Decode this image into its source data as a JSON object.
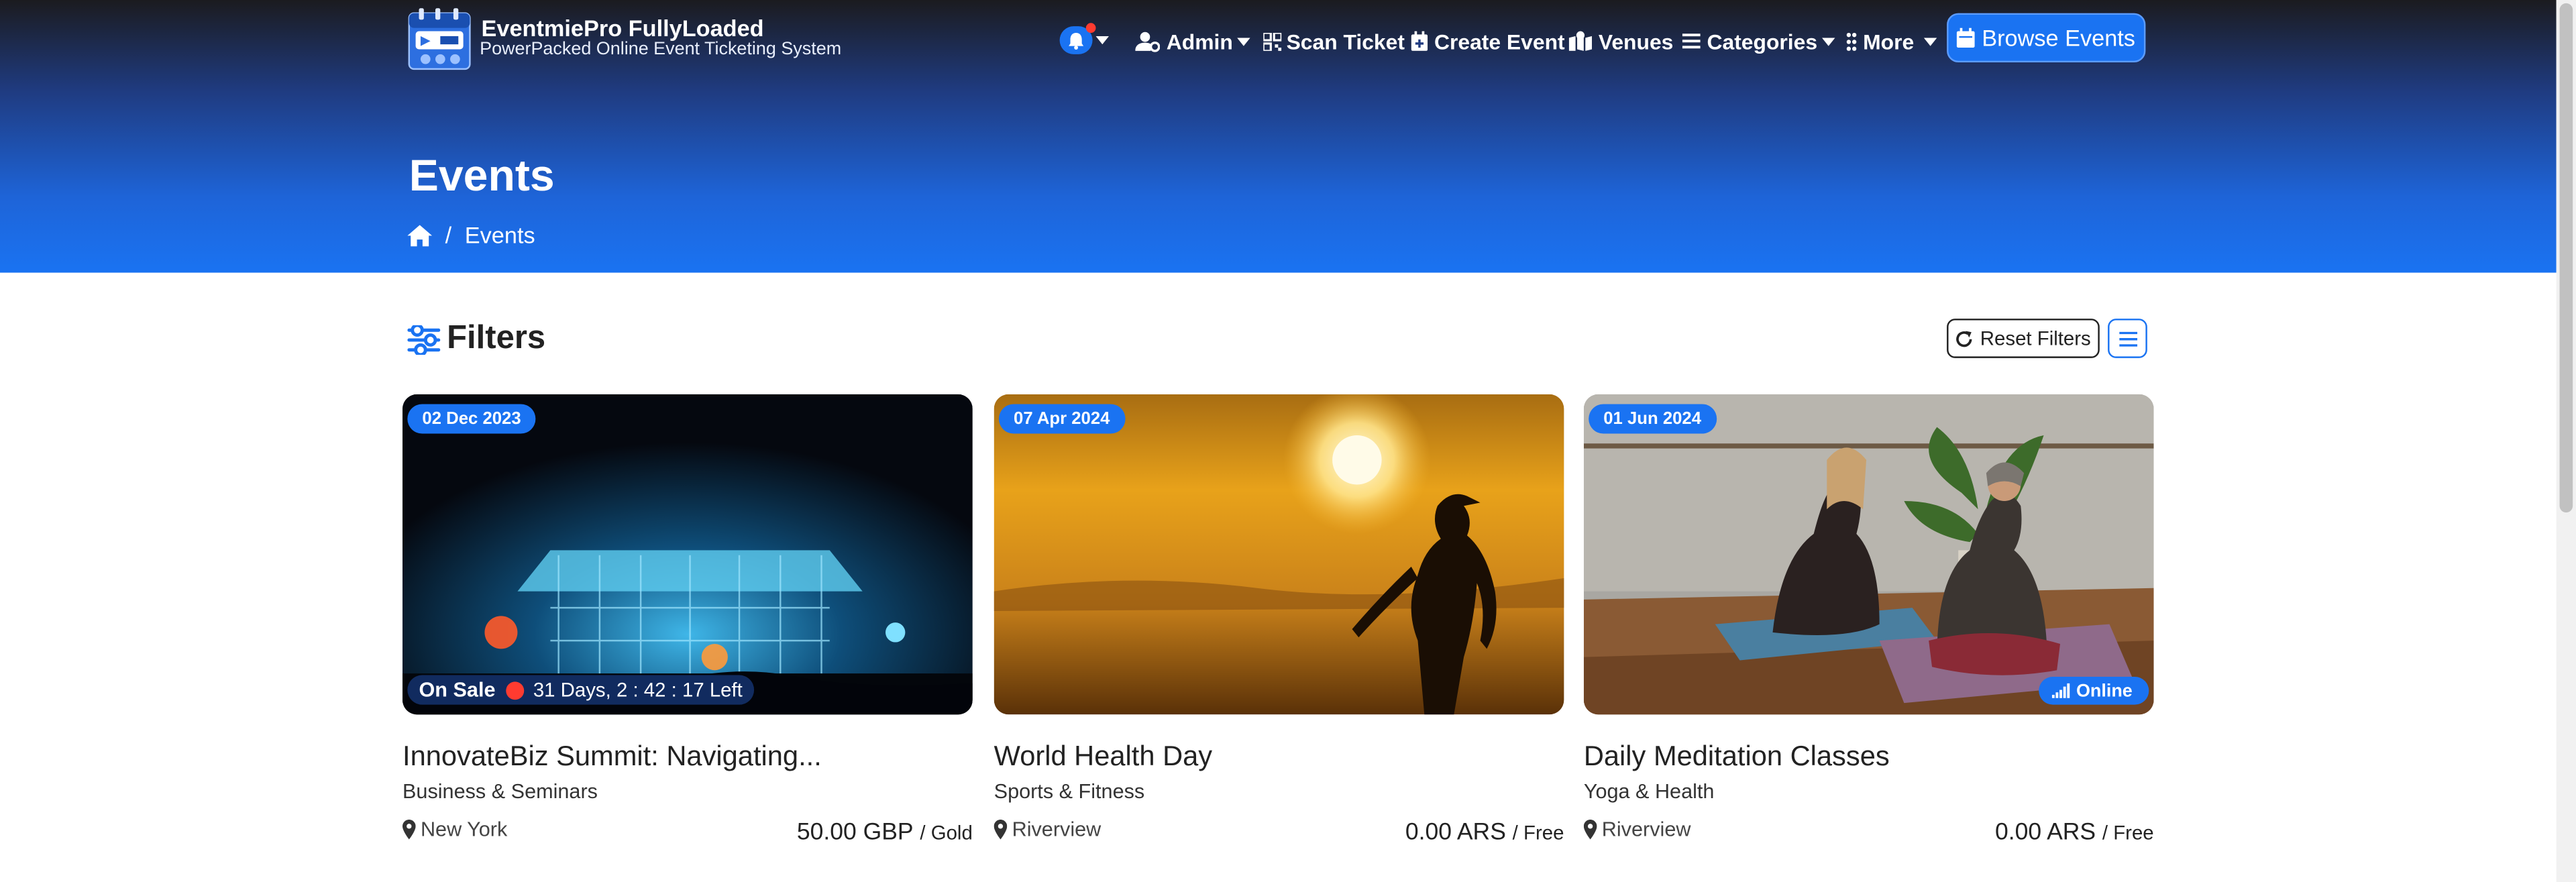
{
  "brand": {
    "title": "EventmiePro FullyLoaded",
    "subtitle": "PowerPacked Online Event Ticketing System"
  },
  "nav": {
    "admin": "Admin",
    "scan_ticket": "Scan Ticket",
    "create_event": "Create Event",
    "venues": "Venues",
    "categories": "Categories",
    "more": "More",
    "browse_events": "Browse Events"
  },
  "page": {
    "title": "Events",
    "breadcrumb_separator": "/",
    "breadcrumb_current": "Events"
  },
  "filters": {
    "title": "Filters",
    "reset_label": "Reset Filters"
  },
  "events": [
    {
      "date": "02 Dec 2023",
      "title": "InnovateBiz Summit: Navigating...",
      "category": "Business & Seminars",
      "location": "New York",
      "price": "50.00 GBP",
      "tier": "/ Gold",
      "on_sale_label": "On Sale",
      "countdown": "31 Days, 2 : 42 : 17 Left"
    },
    {
      "date": "07 Apr 2024",
      "title": "World Health Day",
      "category": "Sports & Fitness",
      "location": "Riverview",
      "price": "0.00 ARS",
      "tier": "/ Free"
    },
    {
      "date": "01 Jun 2024",
      "title": "Daily Meditation Classes",
      "category": "Yoga & Health",
      "location": "Riverview",
      "price": "0.00 ARS",
      "tier": "/ Free",
      "online_label": "Online"
    }
  ],
  "colors": {
    "accent": "#1a73f2",
    "header_dark": "#1b1b1f",
    "sale_dot": "#ff3b30"
  }
}
